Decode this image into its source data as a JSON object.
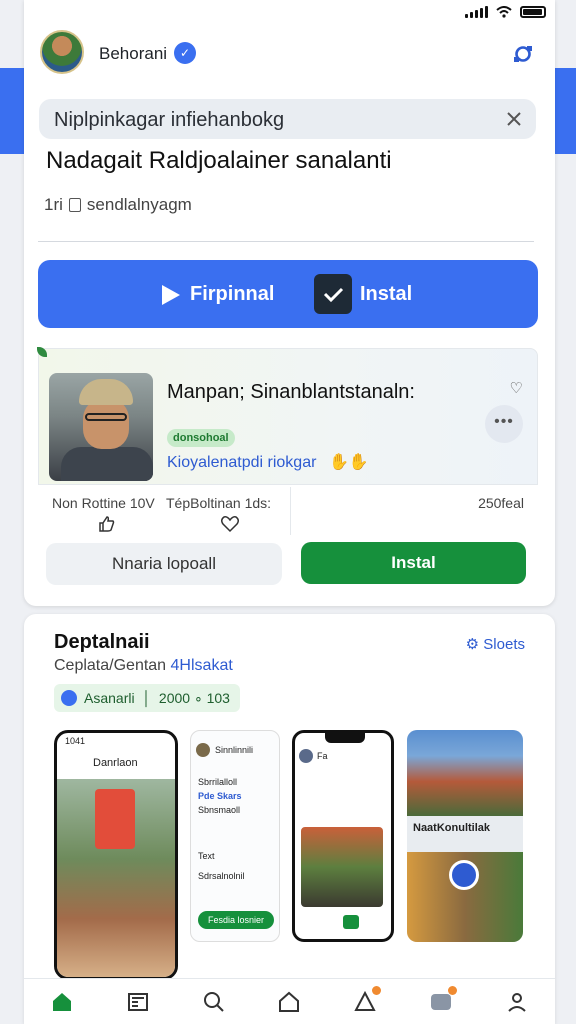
{
  "header": {
    "app_name": "Behorani",
    "search_text": "Niplpinkagar infiehanbokg",
    "headline": "Nadagait Raldjoalainer sanalanti",
    "subline_prefix": "1ri",
    "subline_text": "sendlalnyagm"
  },
  "cta": {
    "primary_label": "Firpinnal",
    "secondary_label": "Instal",
    "color": "#3a6ff0"
  },
  "feature": {
    "title": "Manpan; Sinanblantstanaln:",
    "chip": "donsohoal",
    "link": "Kioyalenatpdi riokgar",
    "stat_left": "Non Rottine 10V",
    "stat_middle": "TépBoltinan 1ds:",
    "stat_right": "250feal",
    "btn_secondary": "Nnaria lopoall",
    "btn_primary": "Instal",
    "primary_color": "#16903c"
  },
  "section": {
    "title": "Deptalnaii",
    "see_all": "Sloets",
    "subtitle": "Ceplata/Gentan",
    "subtitle_accent": "4Hlsakat",
    "rating_label": "Asanarli",
    "rating_value": "2000 ∘ 103"
  },
  "screenshots": {
    "s1_title": "Danrlaon",
    "s1_time": "1041",
    "s2_title": "Sinnlinnili",
    "s2_line1": "Sbrrilalloll",
    "s2_line2": "Pde Skars",
    "s2_line3": "Sbnsmaoll",
    "s2_line4": "Text",
    "s2_line5": "Sdrsalnolnil",
    "s2_button": "Fesdia losnier",
    "s3_title": "Fa",
    "s4_title": "NaatKonultilak"
  },
  "icons": {
    "verified": "verified-badge-icon",
    "refresh": "refresh-icon",
    "close": "close-icon",
    "play": "play-icon",
    "check": "check-icon",
    "heart": "heart-icon",
    "more": "more-icon",
    "thumb": "thumbs-up-icon",
    "gear": "gear-icon",
    "nav": [
      "home-icon",
      "news-icon",
      "search-icon",
      "house-icon",
      "notifications-icon",
      "games-icon",
      "profile-icon"
    ]
  }
}
